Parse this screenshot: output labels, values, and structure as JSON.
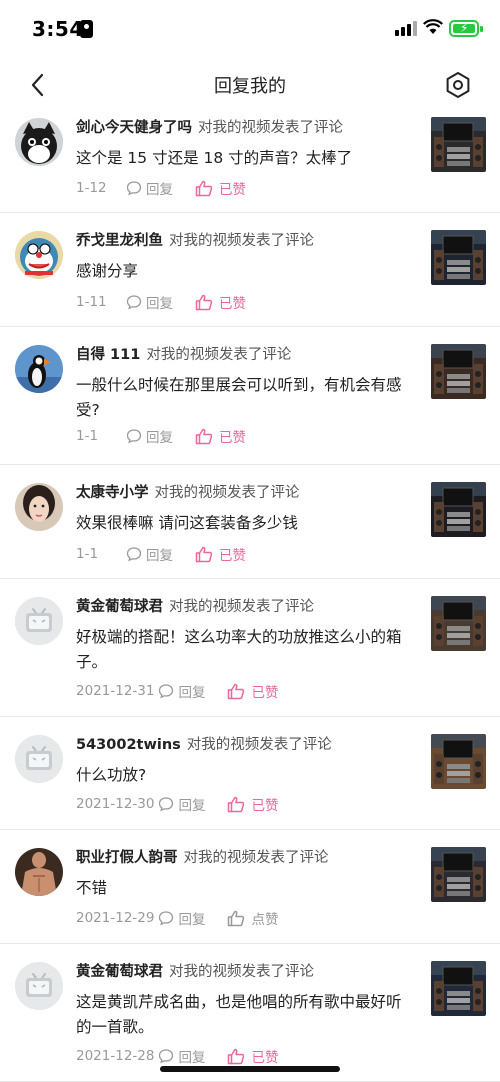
{
  "status_bar": {
    "time": "3:54"
  },
  "header": {
    "title": "回复我的"
  },
  "colors": {
    "accent": "#f0659b"
  },
  "action_text": "对我的视频发表了评论",
  "reply_label": "回复",
  "items": [
    {
      "user": "剑心今天健身了吗",
      "comment": "这个是 15 寸还是 18 寸的声音？太棒了",
      "date": "1-12",
      "like_label": "已赞",
      "liked": true
    },
    {
      "user": "乔戈里龙利鱼",
      "comment": "感谢分享",
      "date": "1-11",
      "like_label": "已赞",
      "liked": true
    },
    {
      "user": "自得 111",
      "comment": "一般什么时候在那里展会可以听到，有机会有感受?",
      "date": "1-1",
      "like_label": "已赞",
      "liked": true
    },
    {
      "user": "太康寺小学",
      "comment": "效果很棒嘛  请问这套装备多少钱",
      "date": "1-1",
      "like_label": "已赞",
      "liked": true
    },
    {
      "user": "黄金葡萄球君",
      "comment": "好极端的搭配！这么功率大的功放推这么小的箱子。",
      "date": "2021-12-31",
      "like_label": "已赞",
      "liked": true
    },
    {
      "user": "543002twins",
      "comment": "什么功放?",
      "date": "2021-12-30",
      "like_label": "已赞",
      "liked": true
    },
    {
      "user": "职业打假人韵哥",
      "comment": "不错",
      "date": "2021-12-29",
      "like_label": "点赞",
      "liked": false
    },
    {
      "user": "黄金葡萄球君",
      "comment": "这是黄凯芹成名曲，也是他唱的所有歌中最好听的一首歌。",
      "date": "2021-12-28",
      "like_label": "已赞",
      "liked": true
    }
  ]
}
